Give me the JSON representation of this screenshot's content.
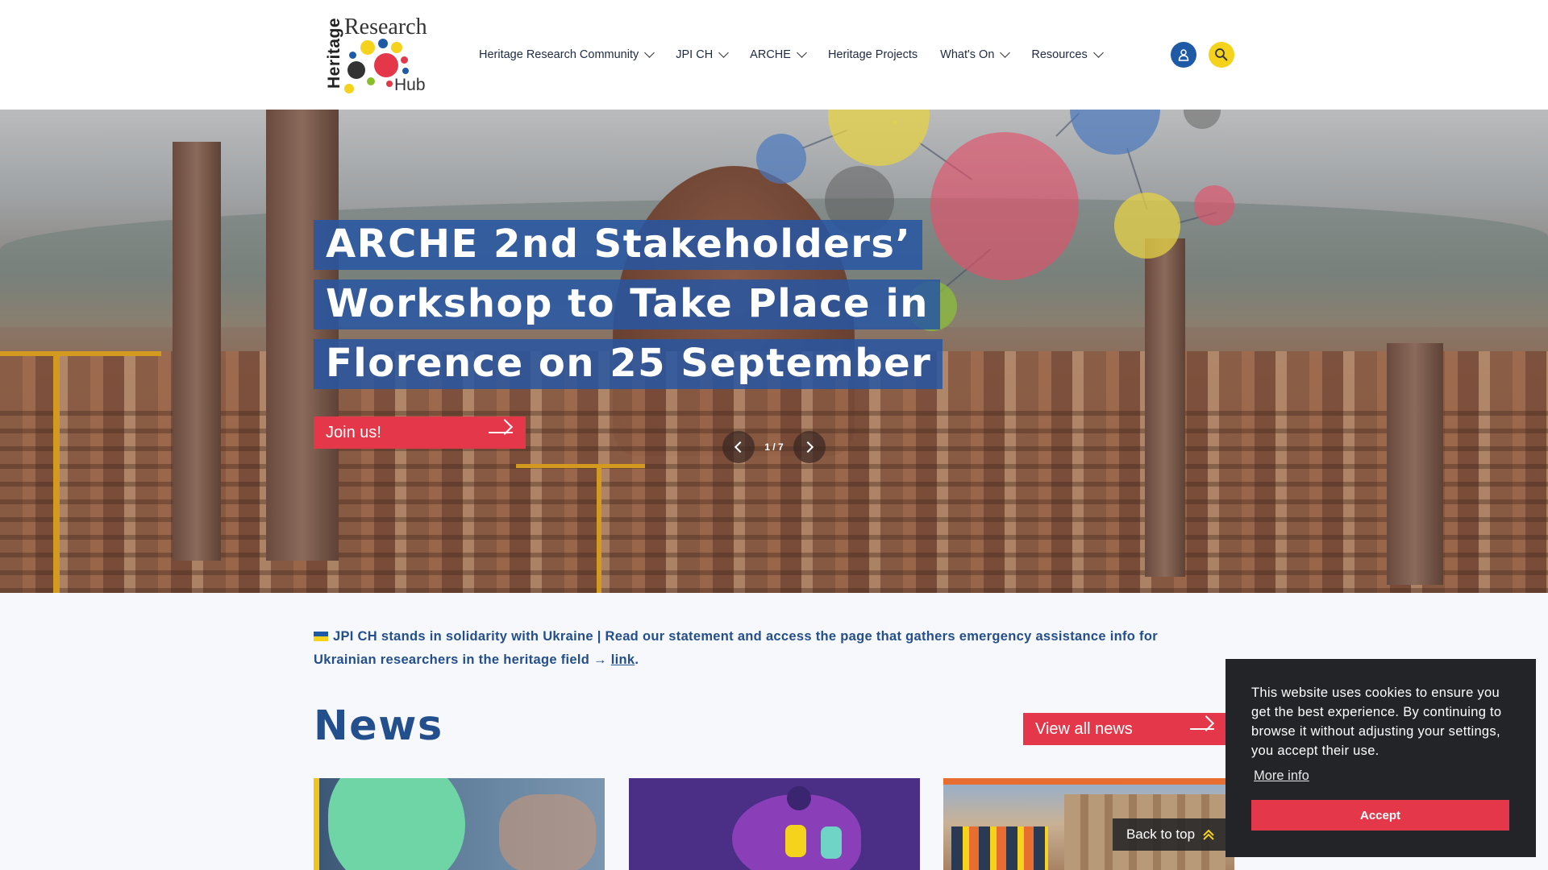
{
  "logo": {
    "word_heritage": "Heritage",
    "word_research": "Research",
    "word_hub": "Hub"
  },
  "nav": {
    "items": [
      {
        "label": "Heritage Research Community",
        "has_dropdown": true
      },
      {
        "label": "JPI CH",
        "has_dropdown": true
      },
      {
        "label": "ARCHE",
        "has_dropdown": true
      },
      {
        "label": "Heritage Projects",
        "has_dropdown": false
      },
      {
        "label": "What's On",
        "has_dropdown": true
      },
      {
        "label": "Resources",
        "has_dropdown": true
      }
    ],
    "user_icon": "user-icon",
    "search_icon": "search-icon"
  },
  "hero": {
    "headline_lines": [
      "ARCHE 2nd Stakeholders’",
      "Workshop to Take Place in",
      "Florence on 25 September"
    ],
    "cta_label": "Join us!",
    "slide_counter": "1 / 7"
  },
  "notice": {
    "text": "JPI CH stands in solidarity with Ukraine | Read our statement and access the page that gathers emergency assistance info for Ukrainian researchers in the heritage field →",
    "link_label": "link",
    "end": "."
  },
  "news": {
    "title": "News",
    "view_all_label": "View all news"
  },
  "back_to_top_label": "Back to top",
  "cookie": {
    "text": "This website uses cookies to ensure you get the best experience. By continuing to browse it without adjusting your settings, you accept their use.",
    "more_info_label": "More info",
    "accept_label": "Accept"
  },
  "colors": {
    "brand_blue": "#234f8c",
    "accent_red": "#e4384a",
    "accent_yellow": "#f5d21b",
    "cookie_bg": "#222428"
  }
}
